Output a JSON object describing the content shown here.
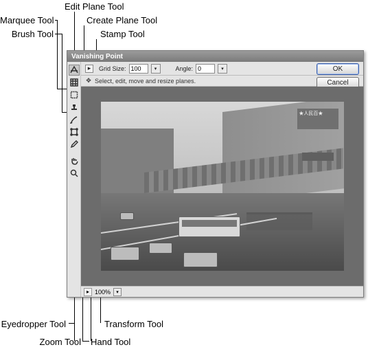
{
  "annotations": {
    "edit_plane": "Edit Plane Tool",
    "marquee": "Marquee Tool",
    "create_plane": "Create Plane Tool",
    "brush": "Brush Tool",
    "stamp": "Stamp Tool",
    "transform": "Transform Tool",
    "eyedropper": "Eyedropper Tool",
    "zoom": "Zoom Tool",
    "hand": "Hand Tool"
  },
  "dialog": {
    "title": "Vanishing Point",
    "hint": "Select, edit, move and resize planes.",
    "ok": "OK",
    "cancel": "Cancel"
  },
  "options": {
    "grid_size_label": "Grid Size:",
    "grid_size_value": "100",
    "angle_label": "Angle:",
    "angle_value": "0"
  },
  "status": {
    "zoom": "100%"
  },
  "image_text": {
    "banner": "★人民百★"
  }
}
